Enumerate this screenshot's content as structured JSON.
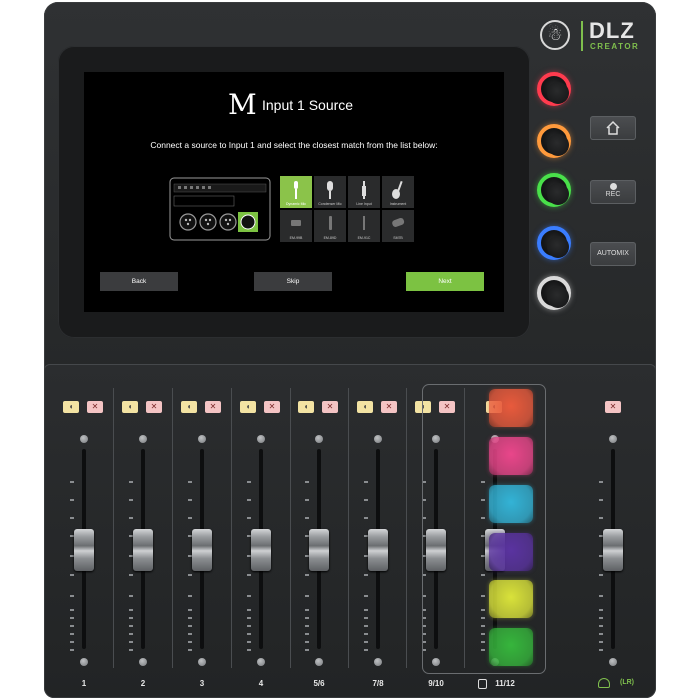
{
  "brand": {
    "logo_symbol": "☃",
    "name": "DLZ",
    "subtitle": "CREATOR",
    "accent": "#7fbf4d"
  },
  "screen": {
    "logo_letter": "M",
    "title": "Input 1 Source",
    "instruction": "Connect a source to Input 1 and select the closest match from the list below:",
    "sources": [
      {
        "label": "Dynamic Mic",
        "icon": "dynamic-mic-icon",
        "selected": true
      },
      {
        "label": "Condenser Mic",
        "icon": "condenser-mic-icon",
        "selected": false
      },
      {
        "label": "Line Input",
        "icon": "line-input-icon",
        "selected": false
      },
      {
        "label": "Instrument",
        "icon": "guitar-icon",
        "selected": false
      },
      {
        "label": "EM-99B",
        "icon": "mic-model-icon",
        "selected": false
      },
      {
        "label": "EM-89D",
        "icon": "mic-model-icon",
        "selected": false
      },
      {
        "label": "EM-91C",
        "icon": "mic-model-icon",
        "selected": false
      },
      {
        "label": "SM7B",
        "icon": "mic-model-icon",
        "selected": false
      }
    ],
    "buttons": {
      "back": "Back",
      "skip": "Skip",
      "next": "Next"
    }
  },
  "encoders": [
    {
      "name": "encoder-1",
      "color": "#ff3b4e"
    },
    {
      "name": "encoder-2",
      "color": "#ff9a3c"
    },
    {
      "name": "encoder-3",
      "color": "#49e04a"
    },
    {
      "name": "encoder-4",
      "color": "#3a7dff"
    },
    {
      "name": "encoder-5",
      "color": "#d9d9d9"
    }
  ],
  "side_buttons": {
    "home_icon": "home-icon",
    "rec": "REC",
    "automix": "AUTOMIX"
  },
  "channels": [
    {
      "label": "1"
    },
    {
      "label": "2"
    },
    {
      "label": "3"
    },
    {
      "label": "4"
    },
    {
      "label": "5/6"
    },
    {
      "label": "7/8"
    },
    {
      "label": "9/10"
    }
  ],
  "usb_channel": {
    "label": "11/12",
    "icon": "usb-icon"
  },
  "main_channel": {
    "label": "(LR)",
    "icon": "headphones-icon"
  },
  "pads": [
    {
      "color": "#e85a3c"
    },
    {
      "color": "#e9468a"
    },
    {
      "color": "#33b3d6"
    },
    {
      "color": "#5a33a0"
    },
    {
      "color": "#d9e23a"
    },
    {
      "color": "#36b53c"
    }
  ],
  "icons": {
    "cue": "ear-icon",
    "mute": "speaker-mute-icon"
  }
}
